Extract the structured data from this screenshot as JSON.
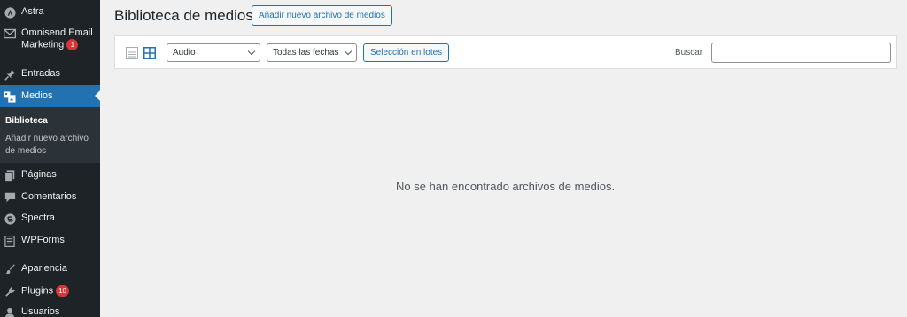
{
  "sidebar": {
    "items": [
      {
        "label": "Astra",
        "icon": "astra-logo-icon"
      },
      {
        "label": "Omnisend Email Marketing",
        "label_line1": "Omnisend Email",
        "label_line2": "Marketing",
        "badge": "1",
        "icon": "envelope-icon"
      },
      {
        "label": "Entradas",
        "icon": "pin-icon"
      },
      {
        "label": "Medios",
        "icon": "media-icon",
        "active": true
      },
      {
        "label": "Páginas",
        "icon": "page-icon"
      },
      {
        "label": "Comentarios",
        "icon": "comment-icon"
      },
      {
        "label": "Spectra",
        "icon": "spectra-icon"
      },
      {
        "label": "WPForms",
        "icon": "form-icon"
      },
      {
        "label": "Apariencia",
        "icon": "brush-icon"
      },
      {
        "label": "Plugins",
        "badge": "10",
        "icon": "plug-icon"
      },
      {
        "label": "Usuarios",
        "icon": "user-icon"
      }
    ],
    "submenu": {
      "current": "Biblioteca",
      "add_new_line1": "Añadir nuevo archivo",
      "add_new_line2": "de medios"
    }
  },
  "header": {
    "title": "Biblioteca de medios",
    "add_button": "Añadir nuevo archivo de medios"
  },
  "toolbar": {
    "type_filter": "Audio",
    "date_filter": "Todas las fechas",
    "bulk_select": "Selección en lotes",
    "search_label": "Buscar",
    "search_value": ""
  },
  "main": {
    "empty_message": "No se han encontrado archivos de medios."
  },
  "colors": {
    "sidebar_bg": "#1d2327",
    "accent": "#2271b1",
    "badge": "#d63638",
    "page_bg": "#f0f0f1"
  }
}
